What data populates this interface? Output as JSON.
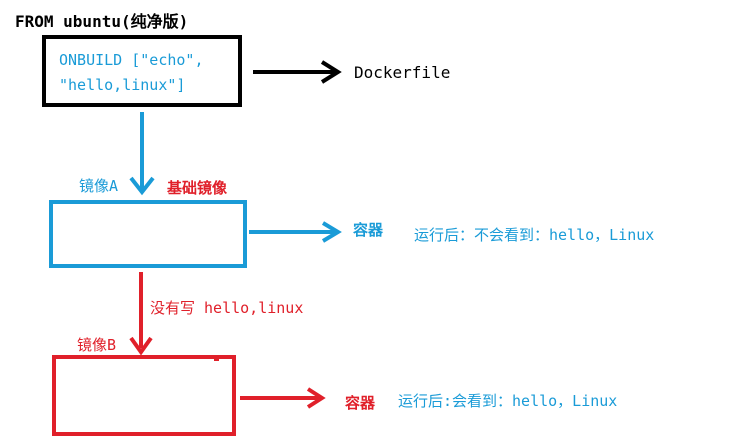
{
  "top_label": "FROM ubuntu(纯净版)",
  "onbuild_box": {
    "line1": "ONBUILD [\"echo\",",
    "line2": "\"hello,linux\"]"
  },
  "dockerfile_label": "Dockerfile",
  "image_a": {
    "label": "镜像A",
    "base_label": "基础镜像",
    "container_label": "容器",
    "result_text": "运行后：不会看到：hello，Linux"
  },
  "no_write_label": "没有写 hello,linux",
  "image_b": {
    "label": "镜像B",
    "container_label": "容器",
    "result_text": "运行后:会看到：hello，Linux"
  },
  "colors": {
    "black": "#000000",
    "blue": "#1a9bd7",
    "red": "#e0202a"
  }
}
